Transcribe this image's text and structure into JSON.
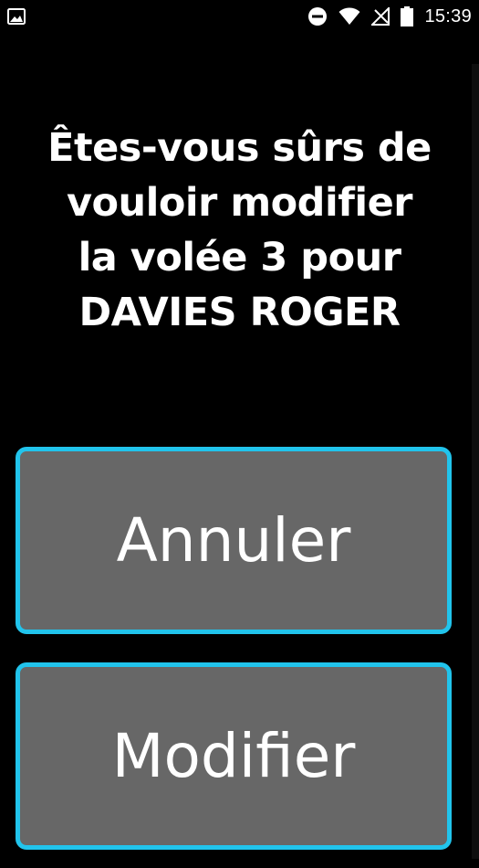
{
  "status_bar": {
    "time": "15:39",
    "icons": [
      "image-icon",
      "do-not-disturb-icon",
      "wifi-icon",
      "no-signal-icon",
      "battery-icon"
    ]
  },
  "dialog": {
    "message_lines": [
      "Êtes-vous sûrs de",
      "vouloir modifier",
      "la volée 3 pour",
      "DAVIES ROGER"
    ],
    "cancel_label": "Annuler",
    "confirm_label": "Modifier"
  },
  "colors": {
    "background": "#000000",
    "button_fill": "#676767",
    "button_border": "#21c4ec",
    "text": "#ffffff"
  }
}
